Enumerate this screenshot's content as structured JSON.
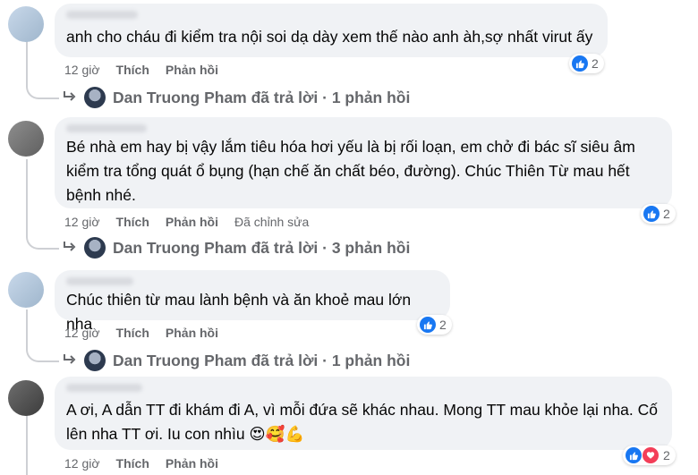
{
  "comments": [
    {
      "text": "anh cho cháu đi kiểm tra nội soi dạ dày xem thế nào anh àh,sợ nhất virut ấy",
      "time": "12 giờ",
      "like_label": "Thích",
      "reply_label": "Phản hồi",
      "edited_label": "",
      "reaction_count": "2",
      "reactions": [
        "like"
      ],
      "reply_summary": {
        "author": "Dan Truong Pham",
        "text": "Dan Truong Pham đã trả lời · 1 phản hồi"
      }
    },
    {
      "text": "Bé nhà em hay bị vậy lắm tiêu hóa hơi yếu là bị rối loạn, em chở đi bác sĩ siêu âm kiểm tra tổng quát ổ bụng (hạn chế ăn chất béo, đường). Chúc Thiên Từ mau hết bệnh nhé.",
      "time": "12 giờ",
      "like_label": "Thích",
      "reply_label": "Phản hồi",
      "edited_label": "Đã chỉnh sửa",
      "reaction_count": "2",
      "reactions": [
        "like"
      ],
      "reply_summary": {
        "author": "Dan Truong Pham",
        "text": "Dan Truong Pham đã trả lời · 3 phản hồi"
      }
    },
    {
      "text": "Chúc thiên từ mau lành bệnh và ăn khoẻ mau lớn nha",
      "time": "12 giờ",
      "like_label": "Thích",
      "reply_label": "Phản hồi",
      "edited_label": "",
      "reaction_count": "2",
      "reactions": [
        "like"
      ],
      "reply_summary": {
        "author": "Dan Truong Pham",
        "text": "Dan Truong Pham đã trả lời · 1 phản hồi"
      }
    },
    {
      "text": "A ơi, A dẫn TT đi khám đi A, vì mỗi đứa sẽ khác nhau. Mong TT mau khỏe lại nha. Cố lên nha TT ơi. Iu con nhìu 😍🥰💪",
      "time": "12 giờ",
      "like_label": "Thích",
      "reply_label": "Phản hồi",
      "edited_label": "",
      "reaction_count": "2",
      "reactions": [
        "like",
        "love"
      ],
      "reply_summary": null
    }
  ],
  "colors": {
    "like": "#1877f2",
    "love": "#f33e58",
    "bubble": "#f0f2f5",
    "meta": "#65676b"
  },
  "icons": {
    "like": "thumbs-up-icon",
    "love": "heart-icon",
    "reply": "reply-arrow-icon"
  }
}
